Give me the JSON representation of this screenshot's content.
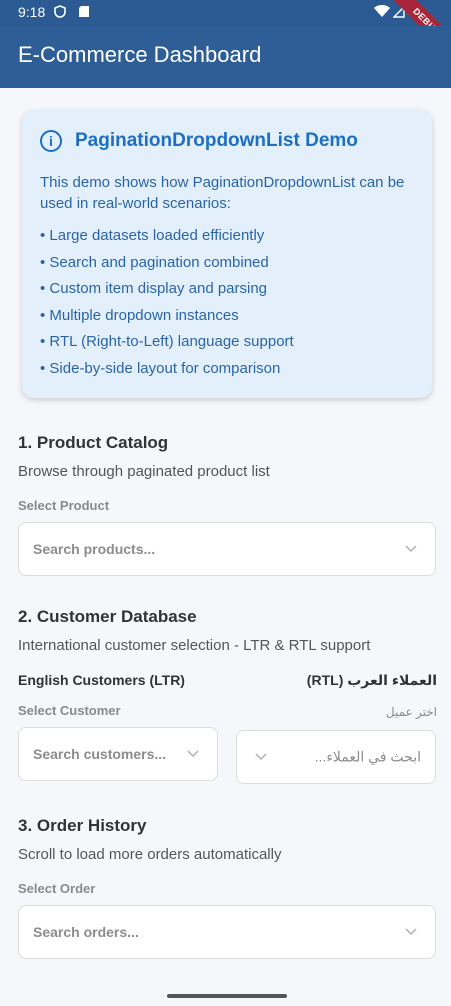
{
  "status_bar": {
    "time": "9:18",
    "debug_label": "DEBUG"
  },
  "app_bar": {
    "title": "E-Commerce Dashboard"
  },
  "info_card": {
    "title": "PaginationDropdownList Demo",
    "description": "This demo shows how PaginationDropdownList can be used in real-world scenarios:",
    "bullets": [
      "• Large datasets loaded efficiently",
      "• Search and pagination combined",
      "• Custom item display and parsing",
      "• Multiple dropdown instances",
      "• RTL (Right-to-Left) language support",
      "• Side-by-side layout for comparison"
    ]
  },
  "product_section": {
    "title": "1. Product Catalog",
    "subtitle": "Browse through paginated product list",
    "label": "Select Product",
    "placeholder": "Search products..."
  },
  "customer_section": {
    "title": "2. Customer Database",
    "subtitle": "International customer selection - LTR & RTL support",
    "ltr": {
      "heading": "English Customers (LTR)",
      "label": "Select Customer",
      "placeholder": "Search customers..."
    },
    "rtl": {
      "heading": "العملاء العرب (RTL)",
      "label": "اختر عميل",
      "placeholder": "ابحث في العملاء..."
    }
  },
  "order_section": {
    "title": "3. Order History",
    "subtitle": "Scroll to load more orders automatically",
    "label": "Select Order",
    "placeholder": "Search orders..."
  },
  "colors": {
    "app_bar": "#2e5e95",
    "accent": "#1e6fc4",
    "card_bg": "#e3f0fb"
  }
}
